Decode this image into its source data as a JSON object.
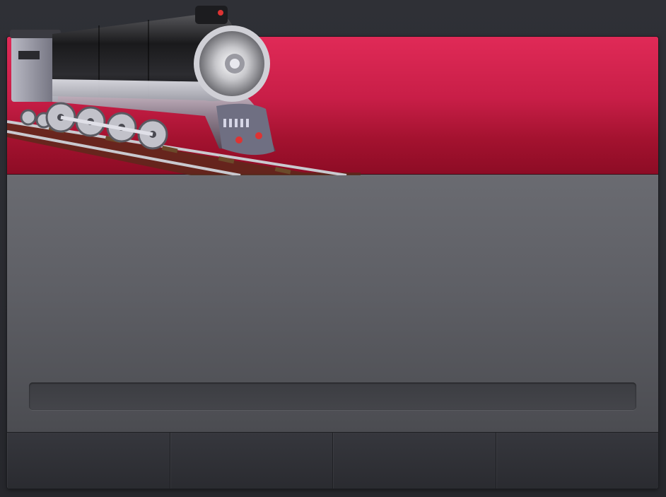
{
  "banner": {
    "title": "",
    "accent_color": "#c81e47"
  },
  "progress": {
    "value": 0,
    "label": ""
  },
  "toolbar": {
    "buttons": [
      "",
      "",
      "",
      ""
    ]
  },
  "colors": {
    "window_bg": "#57585e",
    "toolbar_bg": "#2a2b30",
    "body_bg": "#2b2c31"
  }
}
